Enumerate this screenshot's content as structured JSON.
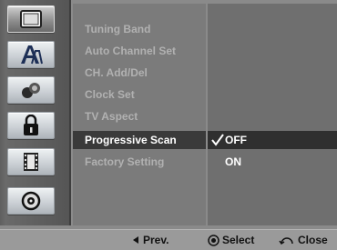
{
  "icons": [
    {
      "name": "tv-screen-icon",
      "active": true
    },
    {
      "name": "language-icon",
      "active": false
    },
    {
      "name": "audio-icon",
      "active": false
    },
    {
      "name": "lock-icon",
      "active": false
    },
    {
      "name": "film-icon",
      "active": false
    },
    {
      "name": "disc-icon",
      "active": false
    }
  ],
  "menu": {
    "items": [
      {
        "label": "Tuning Band"
      },
      {
        "label": "Auto Channel Set"
      },
      {
        "label": "CH. Add/Del"
      },
      {
        "label": "Clock Set"
      },
      {
        "label": "TV Aspect"
      },
      {
        "label": "Progressive Scan",
        "selected": true
      },
      {
        "label": "Factory Setting"
      }
    ]
  },
  "options": {
    "items": [
      {
        "label": "OFF",
        "selected": true,
        "checked": true
      },
      {
        "label": "ON",
        "selected": false,
        "checked": false
      }
    ]
  },
  "footer": {
    "prev_label": "Prev.",
    "select_label": "Select",
    "close_label": "Close"
  },
  "colors": {
    "selected_bg": "#3a3a3a",
    "menu_text": "#b1b1b1",
    "active_text": "#ffffff"
  }
}
